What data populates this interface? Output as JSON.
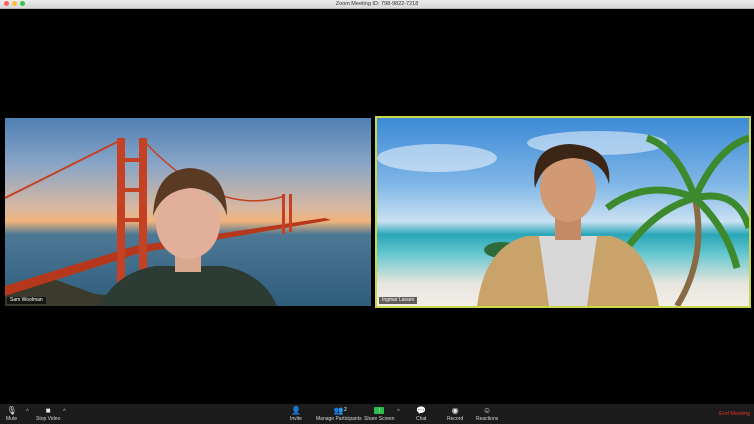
{
  "window": {
    "title": "Zoom Meeting ID: 798-9822-7218"
  },
  "participants": [
    {
      "name": "Sam Woolman"
    },
    {
      "name": "Ingmar Larsen"
    }
  ],
  "toolbar": {
    "mute_label": "Mute",
    "stop_video_label": "Stop Video",
    "invite_label": "Invite",
    "manage_participants_label": "Manage Participants",
    "participant_count": "2",
    "share_screen_label": "Share Screen",
    "chat_label": "Chat",
    "record_label": "Record",
    "reactions_label": "Reactions",
    "end_meeting_label": "End Meeting"
  },
  "colors": {
    "active_speaker_border": "#c8d84a",
    "share_green": "#2dbd4f",
    "end_red": "#e2342b"
  },
  "icons": [
    "mic-icon",
    "video-camera-icon",
    "invite-icon",
    "participants-icon",
    "share-screen-icon",
    "chat-icon",
    "record-icon",
    "reactions-icon",
    "chevron-up-icon"
  ]
}
